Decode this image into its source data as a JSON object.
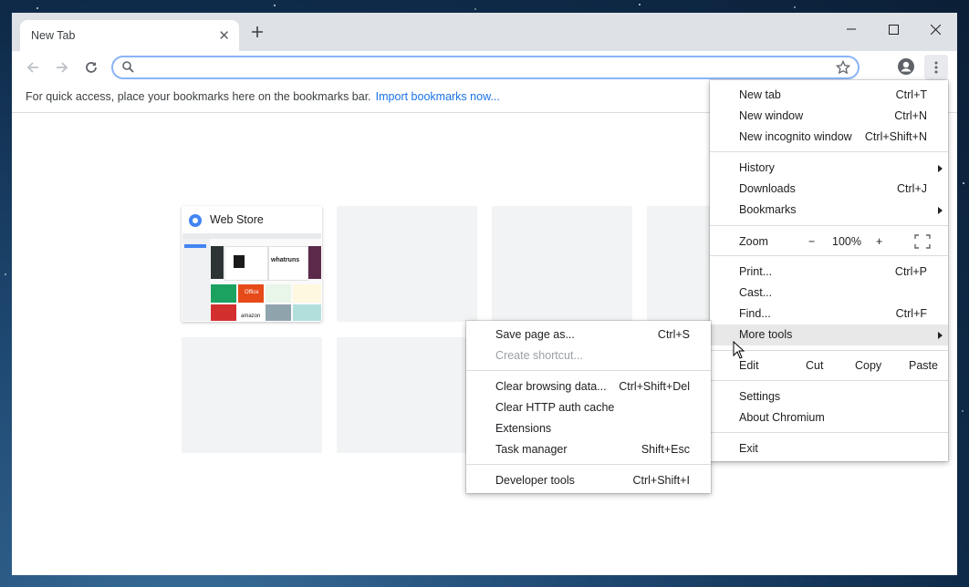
{
  "tab": {
    "title": "New Tab"
  },
  "omnibox": {
    "value": "",
    "placeholder": ""
  },
  "bookmarks_bar": {
    "message": "For quick access, place your bookmarks here on the bookmarks bar.",
    "import_link": "Import bookmarks now..."
  },
  "tiles": [
    {
      "title": "Web Store"
    }
  ],
  "thumbnail_text": {
    "brand": "whatruns",
    "office": "Office",
    "amazon": "amazon"
  },
  "main_menu": {
    "new_tab": {
      "label": "New tab",
      "shortcut": "Ctrl+T"
    },
    "new_window": {
      "label": "New window",
      "shortcut": "Ctrl+N"
    },
    "new_incognito": {
      "label": "New incognito window",
      "shortcut": "Ctrl+Shift+N"
    },
    "history": {
      "label": "History"
    },
    "downloads": {
      "label": "Downloads",
      "shortcut": "Ctrl+J"
    },
    "bookmarks": {
      "label": "Bookmarks"
    },
    "zoom": {
      "label": "Zoom",
      "minus": "−",
      "value": "100%",
      "plus": "+"
    },
    "print": {
      "label": "Print...",
      "shortcut": "Ctrl+P"
    },
    "cast": {
      "label": "Cast..."
    },
    "find": {
      "label": "Find...",
      "shortcut": "Ctrl+F"
    },
    "more_tools": {
      "label": "More tools"
    },
    "edit": {
      "label": "Edit",
      "cut": "Cut",
      "copy": "Copy",
      "paste": "Paste"
    },
    "settings": {
      "label": "Settings"
    },
    "about": {
      "label": "About Chromium"
    },
    "exit": {
      "label": "Exit"
    }
  },
  "submenu": {
    "save_page": {
      "label": "Save page as...",
      "shortcut": "Ctrl+S"
    },
    "create_shortcut": {
      "label": "Create shortcut..."
    },
    "clear_browsing": {
      "label": "Clear browsing data...",
      "shortcut": "Ctrl+Shift+Del"
    },
    "clear_http": {
      "label": "Clear HTTP auth cache"
    },
    "extensions": {
      "label": "Extensions"
    },
    "task_manager": {
      "label": "Task manager",
      "shortcut": "Shift+Esc"
    },
    "dev_tools": {
      "label": "Developer tools",
      "shortcut": "Ctrl+Shift+I"
    }
  },
  "colors": {
    "accent": "#1a73e8",
    "focus_ring": "#8ab4f8",
    "frame": "#dee1e6",
    "highlight": "#e8e8e8"
  }
}
